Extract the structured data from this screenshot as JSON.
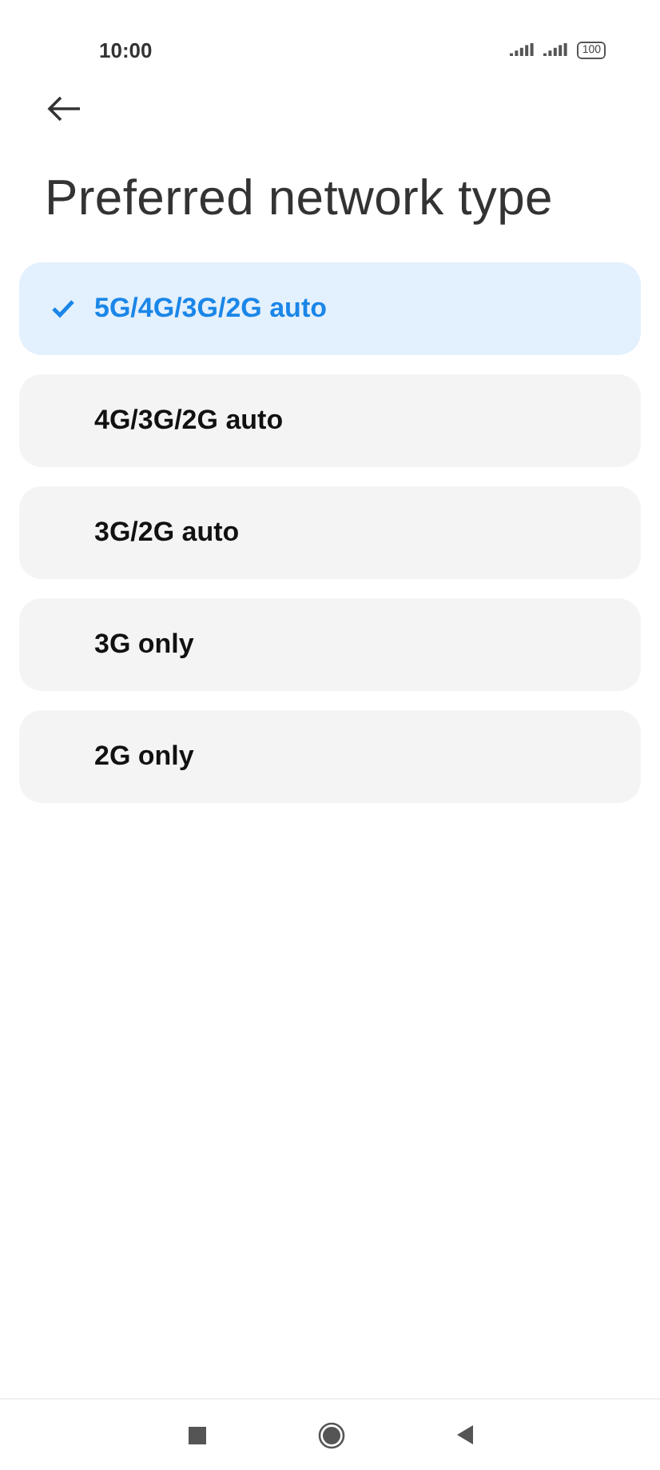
{
  "status_bar": {
    "time": "10:00",
    "battery": "100"
  },
  "title": "Preferred network type",
  "options": [
    {
      "label": "5G/4G/3G/2G auto",
      "selected": true
    },
    {
      "label": "4G/3G/2G auto",
      "selected": false
    },
    {
      "label": "3G/2G auto",
      "selected": false
    },
    {
      "label": "3G only",
      "selected": false
    },
    {
      "label": "2G only",
      "selected": false
    }
  ]
}
